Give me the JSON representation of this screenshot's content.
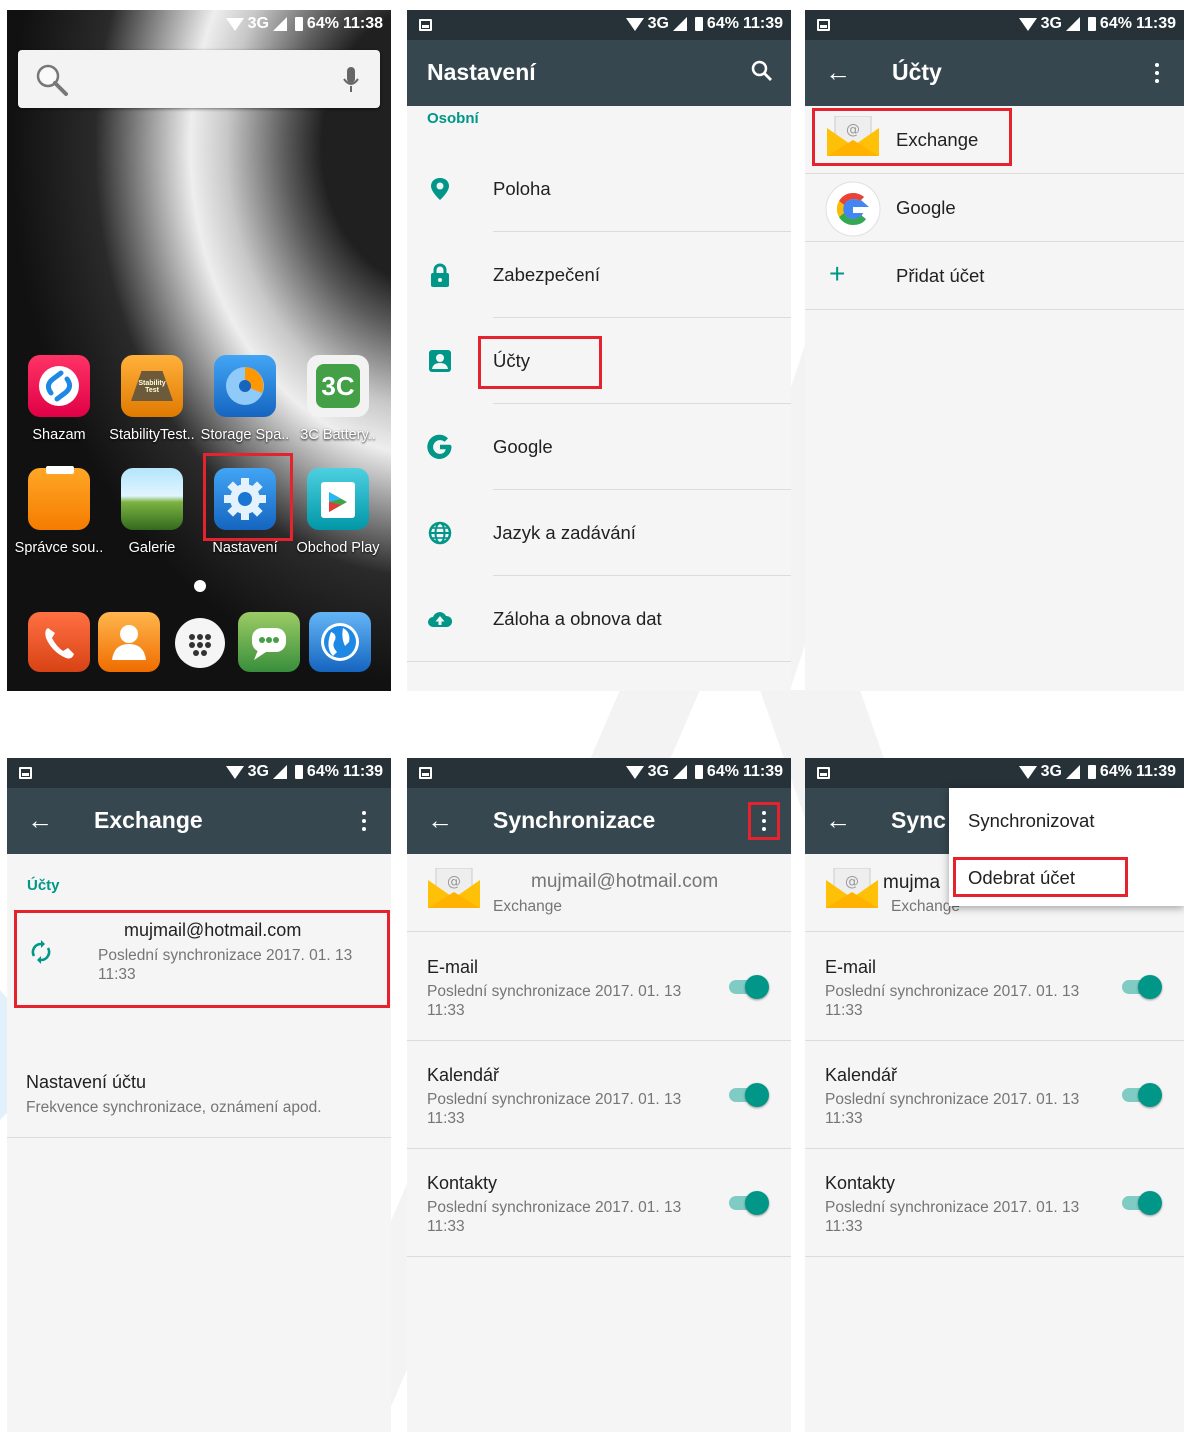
{
  "status": {
    "network": "3G",
    "battery": "64%",
    "time_1": "11:38",
    "time": "11:39"
  },
  "home": {
    "apps_row1": [
      "Shazam",
      "StabilityTest..",
      "Storage Spa..",
      "3C Battery.."
    ],
    "apps_row2": [
      "Správce sou..",
      "Galerie",
      "Nastavení",
      "Obchod Play"
    ],
    "app_icon_text": {
      "stability": "Stability Test",
      "battery": "3C"
    }
  },
  "settings": {
    "title": "Nastavení",
    "section": "Osobní",
    "items": [
      "Poloha",
      "Zabezpečení",
      "Účty",
      "Google",
      "Jazyk a zadávání",
      "Záloha a obnova dat"
    ]
  },
  "accounts": {
    "title": "Účty",
    "items": [
      "Exchange",
      "Google",
      "Přidat účet"
    ]
  },
  "exchange": {
    "title": "Exchange",
    "section": "Účty",
    "email": "mujmail@hotmail.com",
    "last_sync": "Poslední synchronizace 2017. 01. 13 11:33",
    "settings_title": "Nastavení účtu",
    "settings_sub": "Frekvence synchronizace, oznámení apod."
  },
  "sync": {
    "title": "Synchronizace",
    "title_truncated": "Sync",
    "email": "mujmail@hotmail.com",
    "email_truncated": "mujma",
    "account_type": "Exchange",
    "rows": [
      {
        "label": "E-mail",
        "sub": "Poslední synchronizace 2017. 01. 13 11:33"
      },
      {
        "label": "Kalendář",
        "sub": "Poslední synchronizace 2017. 01. 13 11:33"
      },
      {
        "label": "Kontakty",
        "sub": "Poslední synchronizace 2017. 01. 13 11:33"
      }
    ]
  },
  "menu": {
    "items": [
      "Synchronizovat",
      "Odebrat účet"
    ]
  },
  "colors": {
    "accent": "#009688",
    "appbar": "#37474f",
    "statusbar": "#263238",
    "highlight": "#e5232e"
  }
}
